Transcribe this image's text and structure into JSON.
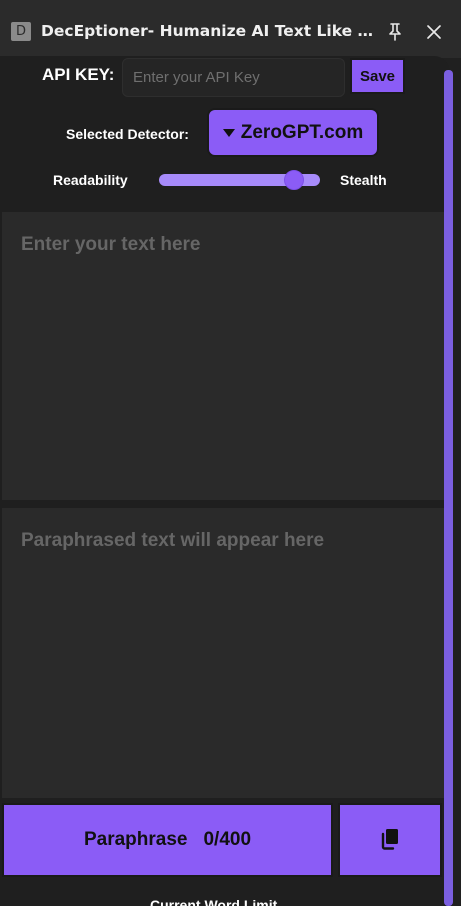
{
  "window": {
    "badge": "D",
    "title": "DecEptioner- Humanize AI Text Like A P...",
    "pin_icon": "pin-icon",
    "close_icon": "close-icon"
  },
  "api": {
    "label": "API KEY:",
    "placeholder": "Enter your API Key",
    "value": "",
    "save_label": "Save"
  },
  "detector": {
    "label": "Selected Detector:",
    "selected": "ZeroGPT.com"
  },
  "slider": {
    "left_label": "Readability",
    "right_label": "Stealth",
    "value": 0.84
  },
  "editor": {
    "input_placeholder": "Enter your text here",
    "output_placeholder": "Paraphrased text will appear here"
  },
  "actions": {
    "paraphrase_label": "Paraphrase",
    "word_count": "0/400",
    "copy_icon": "copy-icon"
  },
  "footer": {
    "word_limit_label": "Current Word Limit"
  },
  "colors": {
    "accent": "#8b5cf6",
    "background": "#1f1f1f",
    "textarea": "#2a2a2a"
  }
}
